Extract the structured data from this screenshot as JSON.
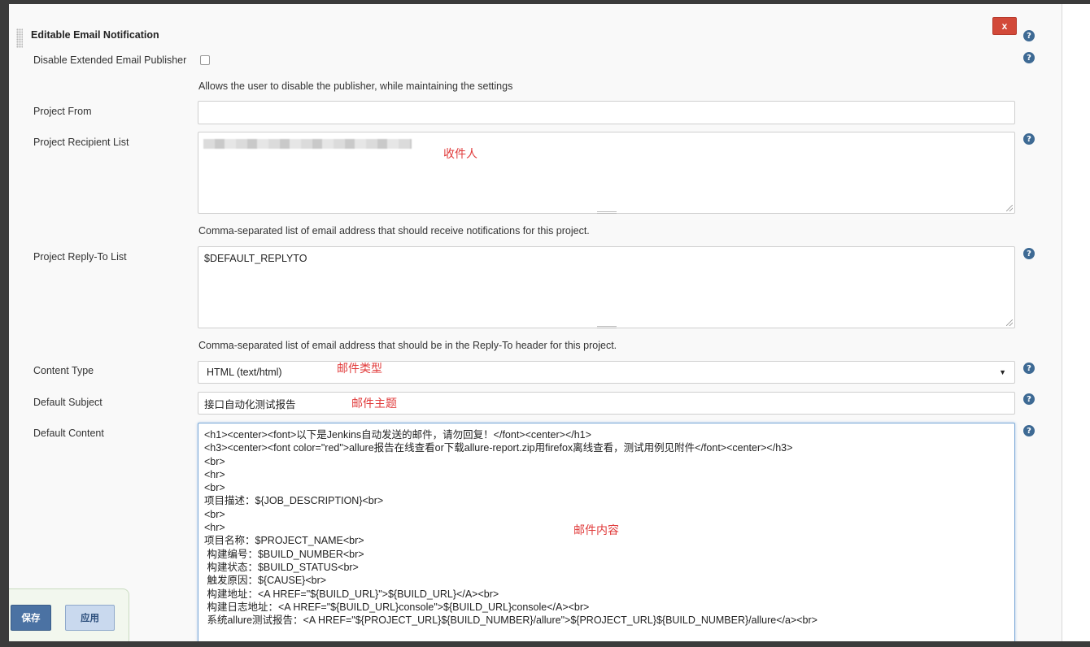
{
  "section": {
    "title": "Editable Email Notification",
    "close_label": "x"
  },
  "help_icon_label": "?",
  "disable_publisher": {
    "label": "Disable Extended Email Publisher",
    "checked": false,
    "description": "Allows the user to disable the publisher, while maintaining the settings"
  },
  "project_from": {
    "label": "Project From",
    "value": ""
  },
  "recipient_list": {
    "label": "Project Recipient List",
    "annotation": "收件人",
    "description": "Comma-separated list of email address that should receive notifications for this project."
  },
  "reply_to": {
    "label": "Project Reply-To List",
    "value": "$DEFAULT_REPLYTO",
    "description": "Comma-separated list of email address that should be in the Reply-To header for this project."
  },
  "content_type": {
    "label": "Content Type",
    "value": "HTML (text/html)",
    "annotation": "邮件类型"
  },
  "default_subject": {
    "label": "Default Subject",
    "value": "接口自动化测试报告",
    "annotation": "邮件主题"
  },
  "default_content": {
    "label": "Default Content",
    "annotation": "邮件内容",
    "value": "<h1><center><font>以下是Jenkins自动发送的邮件，请勿回复！</font><center></h1>\n<h3><center><font color=\"red\">allure报告在线查看or下载allure-report.zip用firefox离线查看，测试用例见附件</font><center></h3>\n<br>\n<hr>\n<br>\n项目描述：${JOB_DESCRIPTION}<br>\n<br>\n<hr>\n项目名称：$PROJECT_NAME<br>\n 构建编号：$BUILD_NUMBER<br>\n 构建状态：$BUILD_STATUS<br>\n 触发原因：${CAUSE}<br>\n 构建地址：<A HREF=\"${BUILD_URL}\">${BUILD_URL}</A><br>\n 构建日志地址：<A HREF=\"${BUILD_URL}console\">${BUILD_URL}console</A><br>\n 系统allure测试报告：<A HREF=\"${PROJECT_URL}${BUILD_NUMBER}/allure\">${PROJECT_URL}${BUILD_NUMBER}/allure</a><br>"
  },
  "actions": {
    "save_label": "保存",
    "apply_label": "应用"
  },
  "colors": {
    "annotation_red": "#e03a3a",
    "close_red": "#d24939",
    "save_blue": "#4b72a3",
    "help_blue": "#3e6a94"
  }
}
